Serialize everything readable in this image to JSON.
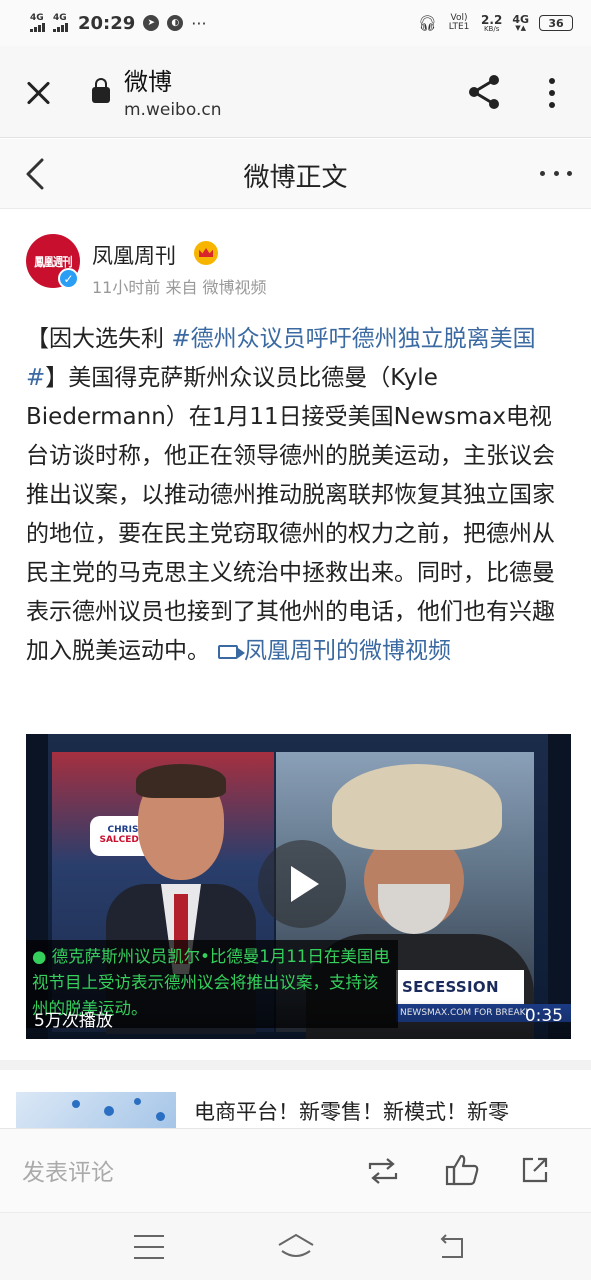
{
  "status_bar": {
    "signal1": "4G",
    "signal2": "4G",
    "time": "20:29",
    "volte": "Vol) LTE1",
    "speed": "2.2",
    "speed_unit": "KB/s",
    "net3": "4G",
    "battery": "36"
  },
  "browser": {
    "site_title": "微博",
    "url": "m.weibo.cn"
  },
  "header": {
    "title": "微博正文"
  },
  "post": {
    "avatar_text": "鳳凰週刊",
    "author": "凤凰周刊",
    "meta": "11小时前 来自 微博视频",
    "text_prefix": "【因大选失利 ",
    "topic": "#德州众议员呼吁德州独立脱离美国#",
    "text_body": "】美国得克萨斯州众议员比德曼（Kyle Biedermann）在1月11日接受美国Newsmax电视台访谈时称，他正在领导德州的脱美运动，主张议会推出议案，以推动德州推动脱离联邦恢复其独立国家的地位，要在民主党窃取德州的权力之前，把德州从民主党的马克思主义统治中拯救出来。同时，比德曼表示德州议员也接到了其他州的电话，他们也有兴趣加入脱美运动中。",
    "video_link": "凤凰周刊的微博视频"
  },
  "video": {
    "caption": "● 德克萨斯州议员凯尔•比德曼1月11日在美国电视节目上受访表示德州议会将推出议案，支持该州的脱美运动。",
    "play_count": "5万次播放",
    "duration": "0:35",
    "banner": "SECESSION",
    "strip": "NEWSMAX.COM FOR BREAKI",
    "logo_top": "CHRIS",
    "logo_bottom": "SALCEDO"
  },
  "recommend": {
    "title": "电商平台！新零售！新模式！新零"
  },
  "comment_bar": {
    "placeholder": "发表评论"
  },
  "icons": {
    "close": "close-icon",
    "lock": "lock-icon",
    "share": "share-icon",
    "more_vertical": "more-vertical-icon",
    "back": "back-icon",
    "more_horizontal": "more-horizontal-icon",
    "repost": "repost-icon",
    "like": "like-icon",
    "share_out": "share-out-icon"
  },
  "colors": {
    "link": "#3b6aa3",
    "caption": "#35d05c",
    "brand_red": "#c8102e",
    "verified": "#2a9df4"
  }
}
